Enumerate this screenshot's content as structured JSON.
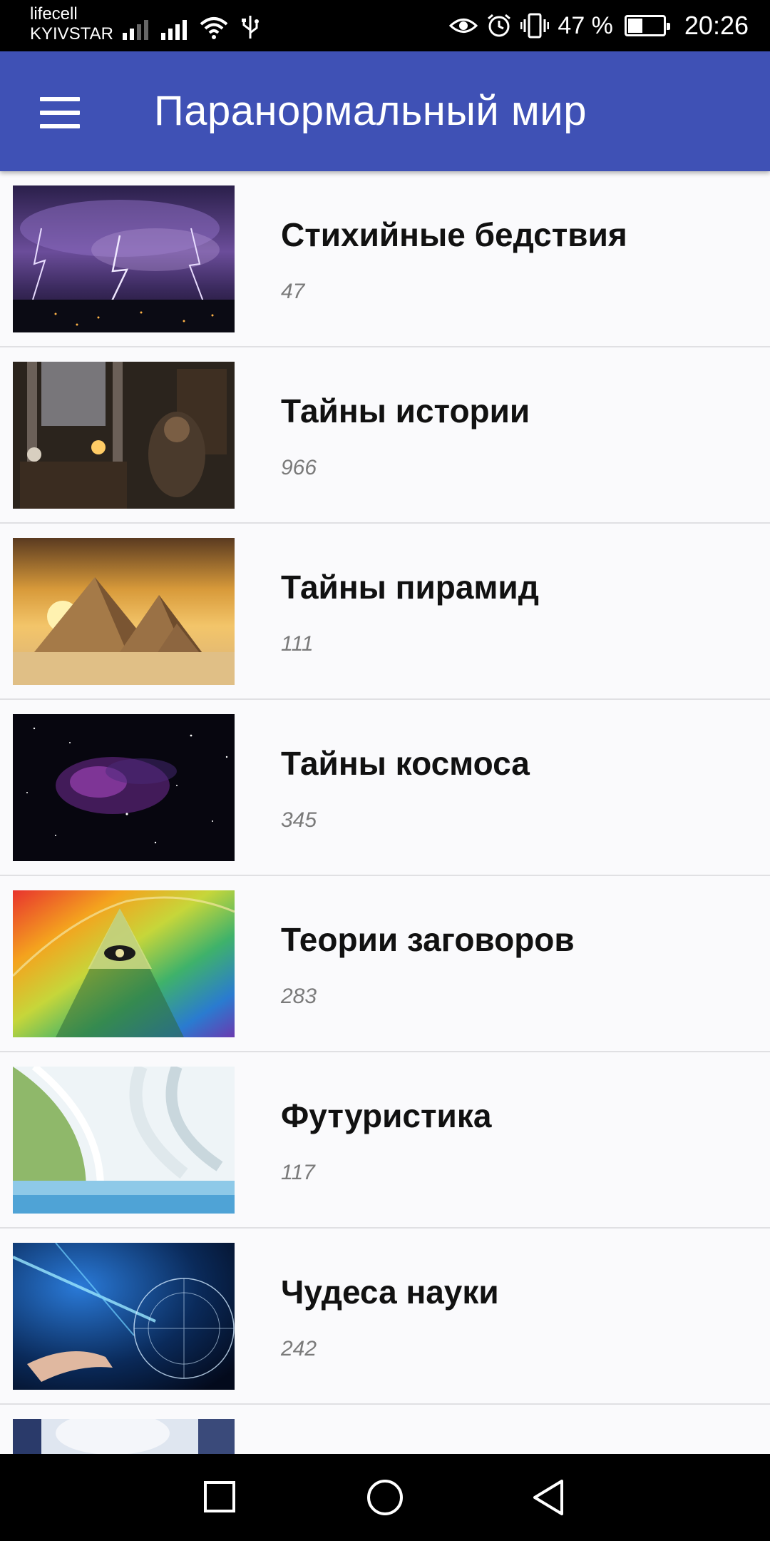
{
  "status_bar": {
    "carrier_line1": "lifecell",
    "carrier_line2": "KYIVSTAR",
    "battery_percent": "47 %",
    "battery_level": 0.47,
    "time": "20:26"
  },
  "app_bar": {
    "title": "Паранормальный мир",
    "menu_icon": "hamburger-menu-icon"
  },
  "categories": [
    {
      "title": "Стихийные бедствия",
      "count": "47"
    },
    {
      "title": "Тайны истории",
      "count": "966"
    },
    {
      "title": "Тайны пирамид",
      "count": "111"
    },
    {
      "title": "Тайны космоса",
      "count": "345"
    },
    {
      "title": "Теории заговоров",
      "count": "283"
    },
    {
      "title": "Футуристика",
      "count": "117"
    },
    {
      "title": "Чудеса науки",
      "count": "242"
    }
  ],
  "nav_bar": {
    "recents_icon": "square-recents-icon",
    "home_icon": "circle-home-icon",
    "back_icon": "triangle-back-icon"
  },
  "colors": {
    "app_bar": "#3f51b5",
    "background": "#fafafc",
    "status_bar": "#000000"
  }
}
